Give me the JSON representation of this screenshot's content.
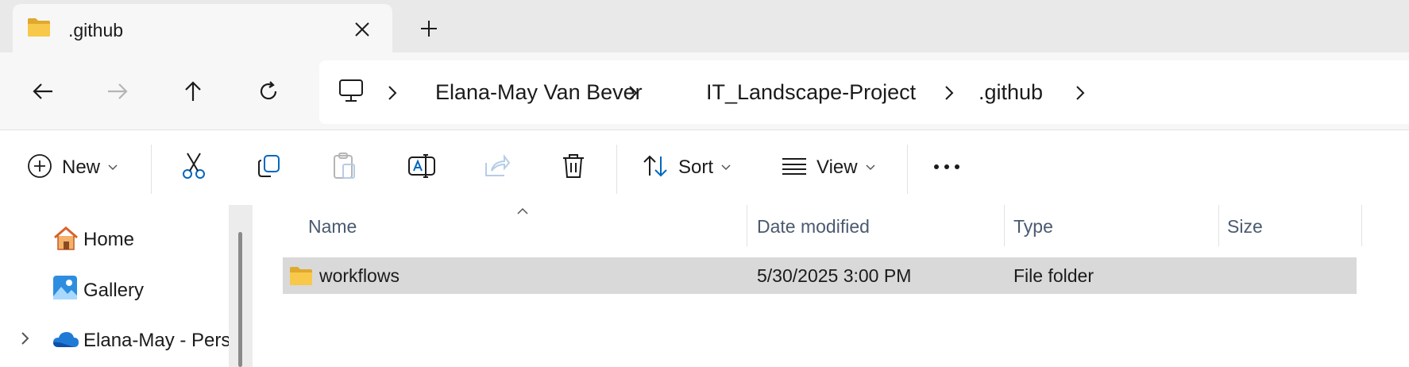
{
  "tab": {
    "title": ".github",
    "close_label": "Close tab",
    "new_tab_label": "New tab"
  },
  "breadcrumb": [
    "Elana-May Van Bever",
    "IT_Landscape-Project",
    ".github"
  ],
  "commands": {
    "new": "New",
    "sort": "Sort",
    "view": "View"
  },
  "navpane": {
    "items": [
      {
        "label": "Home"
      },
      {
        "label": "Gallery"
      },
      {
        "label": "Elana-May - Perso"
      }
    ]
  },
  "columns": [
    "Name",
    "Date modified",
    "Type",
    "Size"
  ],
  "files": [
    {
      "name": "workflows",
      "date": "5/30/2025 3:00 PM",
      "type": "File folder",
      "size": ""
    }
  ],
  "colors": {
    "accent": "#0067c0",
    "folder": "#f8c84a",
    "selection": "#d9d9d9"
  }
}
